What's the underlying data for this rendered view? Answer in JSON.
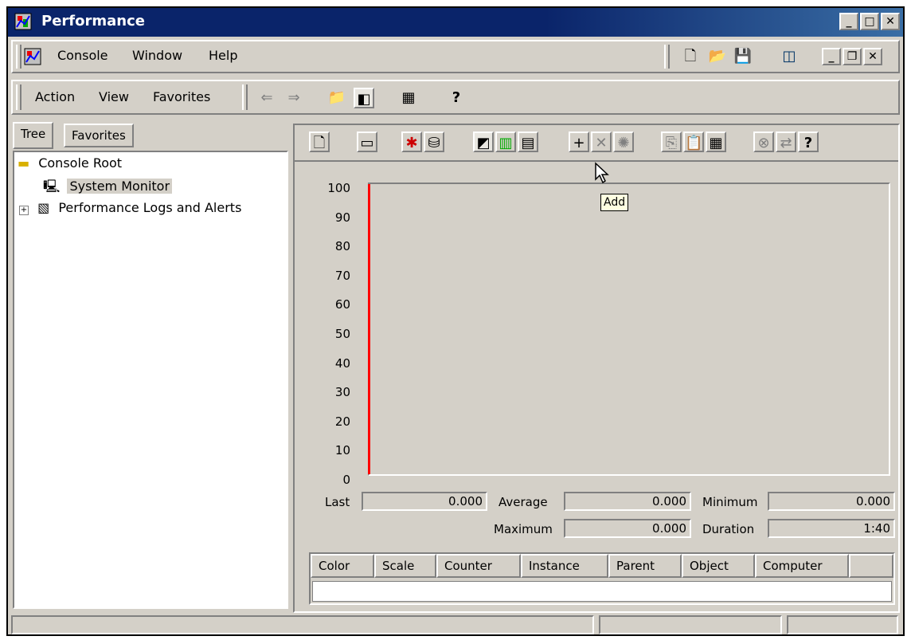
{
  "window": {
    "title": "Performance"
  },
  "menubar": {
    "items": [
      "Console",
      "Window",
      "Help"
    ]
  },
  "actionbar": {
    "items": [
      "Action",
      "View",
      "Favorites"
    ]
  },
  "tabs": [
    "Tree",
    "Favorites"
  ],
  "tree": {
    "root": "Console Root",
    "items": [
      "System Monitor",
      "Performance Logs and Alerts"
    ]
  },
  "graph": {
    "y_ticks": [
      "100",
      "90",
      "80",
      "70",
      "60",
      "50",
      "40",
      "30",
      "20",
      "10",
      "0"
    ],
    "tooltip": "Add"
  },
  "stats": {
    "last_label": "Last",
    "last_value": "0.000",
    "average_label": "Average",
    "average_value": "0.000",
    "minimum_label": "Minimum",
    "minimum_value": "0.000",
    "maximum_label": "Maximum",
    "maximum_value": "0.000",
    "duration_label": "Duration",
    "duration_value": "1:40"
  },
  "legend_columns": [
    "Color",
    "Scale",
    "Counter",
    "Instance",
    "Parent",
    "Object",
    "Computer"
  ],
  "colors": {
    "title_bar": "#0a246a",
    "face": "#d4d0c8",
    "graph_line": "#ff0000"
  }
}
